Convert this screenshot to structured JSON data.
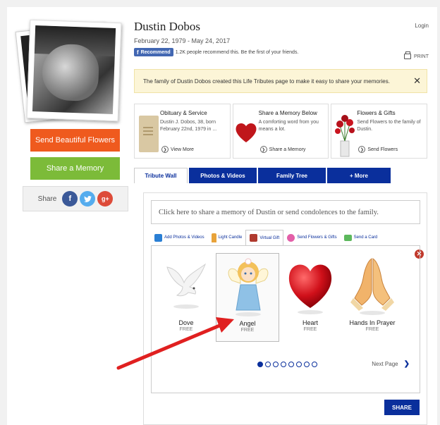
{
  "profile": {
    "name": "Dustin Dobos",
    "dates": "February 22, 1979 - May 24, 2017"
  },
  "header": {
    "login": "Login",
    "print": "PRINT",
    "recommend_label": "Recommend",
    "recommend_text": "1.2K people recommend this. Be the first of your friends."
  },
  "sidebar": {
    "flowers_button": "Send Beautiful Flowers",
    "memory_button": "Share a Memory",
    "share_label": "Share",
    "social": [
      "f",
      "t",
      "g+"
    ]
  },
  "notice": {
    "text": "The family of Dustin Dobos created this Life Tributes page to make it easy to share your memories.",
    "close": "✕"
  },
  "cards": [
    {
      "title": "Obituary & Service",
      "desc": "Dustin J. Dobos, 38, born February 22nd, 1979 in ...",
      "link": "View More",
      "icon": "scroll-icon"
    },
    {
      "title": "Share a Memory Below",
      "desc": "A comforting word from you means a lot.",
      "link": "Share a Memory",
      "icon": "heart-icon"
    },
    {
      "title": "Flowers & Gifts",
      "desc": "Send Flowers to the family of Dustin.",
      "link": "Send Flowers",
      "icon": "flowers-icon"
    }
  ],
  "tabs": [
    {
      "label": "Tribute Wall",
      "active": true
    },
    {
      "label": "Photos & Videos",
      "active": false
    },
    {
      "label": "Family Tree",
      "active": false
    },
    {
      "label": "+ More",
      "active": false
    }
  ],
  "wall": {
    "condolence_placeholder": "Click here to share a memory of Dustin or send condolences to the family.",
    "actions": [
      {
        "label": "Add Photos & Videos",
        "icon": "camera-icon",
        "color": "#2a7fd4"
      },
      {
        "label": "Light Candle",
        "icon": "candle-icon",
        "color": "#e8a33a"
      },
      {
        "label": "Virtual Gift",
        "icon": "gift-icon",
        "color": "#b03a2e",
        "active": true
      },
      {
        "label": "Send Flowers & Gifts",
        "icon": "flower-icon",
        "color": "#e35fa8"
      },
      {
        "label": "Send a Card",
        "icon": "envelope-icon",
        "color": "#5cb85c"
      }
    ],
    "gifts": [
      {
        "name": "Dove",
        "price": "FREE",
        "icon": "dove-icon"
      },
      {
        "name": "Angel",
        "price": "FREE",
        "icon": "angel-icon",
        "selected": true
      },
      {
        "name": "Heart",
        "price": "FREE",
        "icon": "heart-icon"
      },
      {
        "name": "Hands In Prayer",
        "price": "FREE",
        "icon": "praying-hands-icon"
      }
    ],
    "pagination": {
      "current": 1,
      "total": 8
    },
    "next_page": "Next Page",
    "share_button": "SHARE"
  },
  "colors": {
    "navy": "#0a2f9c",
    "orange": "#ef5a1e",
    "green": "#7cbb39",
    "annotation_arrow": "#e02020"
  }
}
